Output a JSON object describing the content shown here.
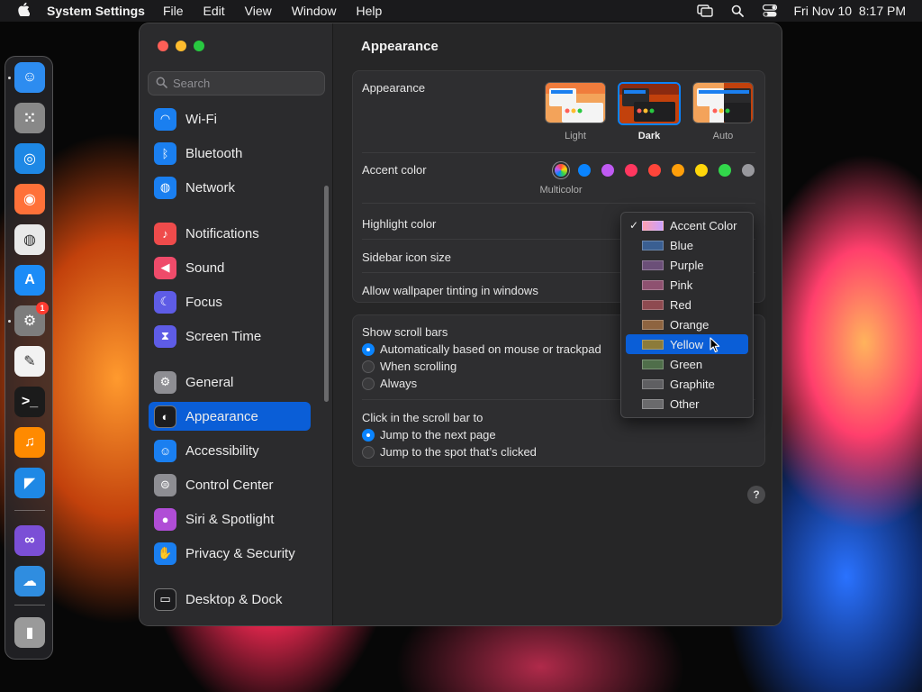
{
  "menubar": {
    "app_name": "System Settings",
    "items": [
      "File",
      "Edit",
      "View",
      "Window",
      "Help"
    ],
    "clock": "Fri Nov 10  8:17 PM"
  },
  "dock": {
    "apps": [
      {
        "name": "finder",
        "color": "#2d8cf0"
      },
      {
        "name": "launchpad",
        "color": "#888888"
      },
      {
        "name": "safari",
        "color": "#1e88e5"
      },
      {
        "name": "firefox",
        "color": "#ff7139"
      },
      {
        "name": "chrome",
        "color": "#e9e9e9"
      },
      {
        "name": "app-store",
        "color": "#1c8cf7"
      },
      {
        "name": "system-settings",
        "color": "#7d7d7d",
        "badge": "1"
      },
      {
        "name": "textedit",
        "color": "#f2f2f2"
      },
      {
        "name": "terminal",
        "color": "#1b1b1b"
      },
      {
        "name": "garageband",
        "color": "#ff8a00"
      },
      {
        "name": "vscode",
        "color": "#1e88e5"
      },
      {
        "name": "visual-studio",
        "color": "#7b4fd6"
      },
      {
        "name": "weather",
        "color": "#2f8de0"
      },
      {
        "name": "trash",
        "color": "#9a9a9a"
      }
    ]
  },
  "search": {
    "placeholder": "Search"
  },
  "sidebar": {
    "items": [
      {
        "label": "Wi-Fi",
        "icon": "wifi-icon",
        "color": "#1a7ff0"
      },
      {
        "label": "Bluetooth",
        "icon": "bluetooth-icon",
        "color": "#1a7ff0"
      },
      {
        "label": "Network",
        "icon": "globe-icon",
        "color": "#1a7ff0"
      },
      {
        "label": "Notifications",
        "icon": "bell-icon",
        "color": "#ef4b4b"
      },
      {
        "label": "Sound",
        "icon": "speaker-icon",
        "color": "#ef4b6a"
      },
      {
        "label": "Focus",
        "icon": "moon-icon",
        "color": "#5e5ce6"
      },
      {
        "label": "Screen Time",
        "icon": "hourglass-icon",
        "color": "#5e5ce6"
      },
      {
        "label": "General",
        "icon": "gear-icon",
        "color": "#8e8e93"
      },
      {
        "label": "Appearance",
        "icon": "appearance-icon",
        "color": "#1c1c1e",
        "selected": true
      },
      {
        "label": "Accessibility",
        "icon": "accessibility-icon",
        "color": "#1a7ff0"
      },
      {
        "label": "Control Center",
        "icon": "toggles-icon",
        "color": "#8e8e93"
      },
      {
        "label": "Siri & Spotlight",
        "icon": "siri-icon",
        "color": "#b04dd6"
      },
      {
        "label": "Privacy & Security",
        "icon": "hand-icon",
        "color": "#1a7ff0"
      },
      {
        "label": "Desktop & Dock",
        "icon": "dock-icon",
        "color": "#1c1c1e"
      }
    ]
  },
  "content": {
    "title": "Appearance",
    "appearance": {
      "label": "Appearance",
      "options": [
        {
          "label": "Light",
          "selected": false
        },
        {
          "label": "Dark",
          "selected": true
        },
        {
          "label": "Auto",
          "selected": false
        }
      ]
    },
    "accent": {
      "label": "Accent color",
      "selected_name": "Multicolor",
      "colors": [
        "#ffffff",
        "#0a84ff",
        "#bf5af2",
        "#ff375f",
        "#ff453a",
        "#ff9f0a",
        "#ffd60a",
        "#32d74b",
        "#98989d"
      ]
    },
    "highlight_label": "Highlight color",
    "sidebar_icon_label": "Sidebar icon size",
    "tinting_label": "Allow wallpaper tinting in windows",
    "scrollbars": {
      "label": "Show scroll bars",
      "options": [
        {
          "label": "Automatically based on mouse or trackpad",
          "selected": true
        },
        {
          "label": "When scrolling",
          "selected": false
        },
        {
          "label": "Always",
          "selected": false
        }
      ]
    },
    "click_scroll": {
      "label": "Click in the scroll bar to",
      "options": [
        {
          "label": "Jump to the next page",
          "selected": true
        },
        {
          "label": "Jump to the spot that’s clicked",
          "selected": false
        }
      ]
    },
    "help": "?"
  },
  "dropdown": {
    "items": [
      {
        "label": "Accent Color",
        "color": "#ff9fb0",
        "checked": true
      },
      {
        "label": "Blue",
        "color": "#3a5f92"
      },
      {
        "label": "Purple",
        "color": "#6b4f78"
      },
      {
        "label": "Pink",
        "color": "#8e5170"
      },
      {
        "label": "Red",
        "color": "#8e4a50"
      },
      {
        "label": "Orange",
        "color": "#8e6440"
      },
      {
        "label": "Yellow",
        "color": "#8c7b3a",
        "hover": true
      },
      {
        "label": "Green",
        "color": "#4f6e4a"
      },
      {
        "label": "Graphite",
        "color": "#5f5f62"
      },
      {
        "label": "Other",
        "color": "#6a6a6c"
      }
    ]
  }
}
